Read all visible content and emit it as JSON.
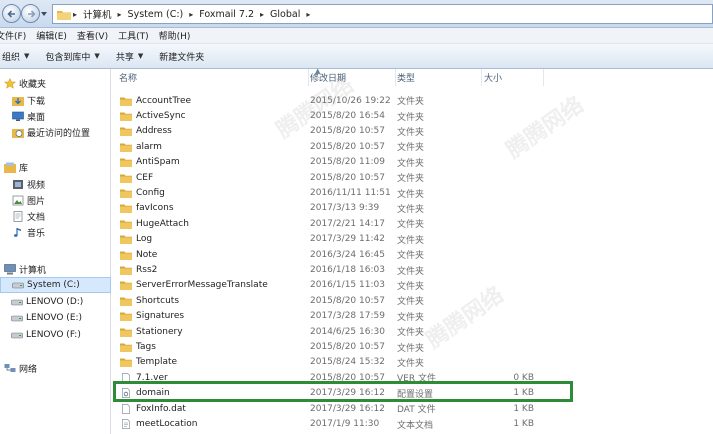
{
  "address": {
    "crumbs": [
      "计算机",
      "System (C:)",
      "Foxmail 7.2",
      "Global"
    ]
  },
  "menu": [
    "文件(F)",
    "编辑(E)",
    "查看(V)",
    "工具(T)",
    "帮助(H)"
  ],
  "toolbar": {
    "organize": "组织",
    "include": "包含到库中",
    "share": "共享",
    "new_folder": "新建文件夹"
  },
  "nav": {
    "favorites": "收藏夹",
    "downloads": "下载",
    "desktop": "桌面",
    "recent": "最近访问的位置",
    "libraries": "库",
    "videos": "视频",
    "pictures": "图片",
    "documents": "文档",
    "music": "音乐",
    "computer": "计算机",
    "drive_c": "System (C:)",
    "drive_d": "LENOVO (D:)",
    "drive_e": "LENOVO (E:)",
    "drive_f": "LENOVO (F:)",
    "network": "网络"
  },
  "columns": {
    "name": "名称",
    "modified": "修改日期",
    "type": "类型",
    "size": "大小"
  },
  "files": [
    {
      "name": "AccountTree",
      "date": "2015/10/26 19:22",
      "type": "文件夹",
      "size": "",
      "kind": "folder"
    },
    {
      "name": "ActiveSync",
      "date": "2015/8/20 16:54",
      "type": "文件夹",
      "size": "",
      "kind": "folder"
    },
    {
      "name": "Address",
      "date": "2015/8/20 10:57",
      "type": "文件夹",
      "size": "",
      "kind": "folder"
    },
    {
      "name": "alarm",
      "date": "2015/8/20 10:57",
      "type": "文件夹",
      "size": "",
      "kind": "folder"
    },
    {
      "name": "AntiSpam",
      "date": "2015/8/20 11:09",
      "type": "文件夹",
      "size": "",
      "kind": "folder"
    },
    {
      "name": "CEF",
      "date": "2015/8/20 10:57",
      "type": "文件夹",
      "size": "",
      "kind": "folder"
    },
    {
      "name": "Config",
      "date": "2016/11/11 11:51",
      "type": "文件夹",
      "size": "",
      "kind": "folder"
    },
    {
      "name": "favIcons",
      "date": "2017/3/13 9:39",
      "type": "文件夹",
      "size": "",
      "kind": "folder"
    },
    {
      "name": "HugeAttach",
      "date": "2017/2/21 14:17",
      "type": "文件夹",
      "size": "",
      "kind": "folder"
    },
    {
      "name": "Log",
      "date": "2017/3/29 11:42",
      "type": "文件夹",
      "size": "",
      "kind": "folder"
    },
    {
      "name": "Note",
      "date": "2016/3/24 16:45",
      "type": "文件夹",
      "size": "",
      "kind": "folder"
    },
    {
      "name": "Rss2",
      "date": "2016/1/18 16:03",
      "type": "文件夹",
      "size": "",
      "kind": "folder"
    },
    {
      "name": "ServerErrorMessageTranslate",
      "date": "2016/1/15 11:03",
      "type": "文件夹",
      "size": "",
      "kind": "folder"
    },
    {
      "name": "Shortcuts",
      "date": "2015/8/20 10:57",
      "type": "文件夹",
      "size": "",
      "kind": "folder"
    },
    {
      "name": "Signatures",
      "date": "2017/3/28 17:59",
      "type": "文件夹",
      "size": "",
      "kind": "folder"
    },
    {
      "name": "Stationery",
      "date": "2014/6/25 16:30",
      "type": "文件夹",
      "size": "",
      "kind": "folder"
    },
    {
      "name": "Tags",
      "date": "2015/8/20 10:57",
      "type": "文件夹",
      "size": "",
      "kind": "folder"
    },
    {
      "name": "Template",
      "date": "2015/8/24 15:32",
      "type": "文件夹",
      "size": "",
      "kind": "folder"
    },
    {
      "name": "7.1.ver",
      "date": "2015/8/20 10:57",
      "type": "VER 文件",
      "size": "0 KB",
      "kind": "file"
    },
    {
      "name": "domain",
      "date": "2017/3/29 16:12",
      "type": "配置设置",
      "size": "1 KB",
      "kind": "config"
    },
    {
      "name": "FoxInfo.dat",
      "date": "2017/3/29 16:12",
      "type": "DAT 文件",
      "size": "1 KB",
      "kind": "file"
    },
    {
      "name": "meetLocation",
      "date": "2017/1/9 11:30",
      "type": "文本文档",
      "size": "1 KB",
      "kind": "text"
    }
  ],
  "colors": {
    "folder": "#e8b84a",
    "highlight": "#2e8b37",
    "selected": "#d6e8fb"
  }
}
